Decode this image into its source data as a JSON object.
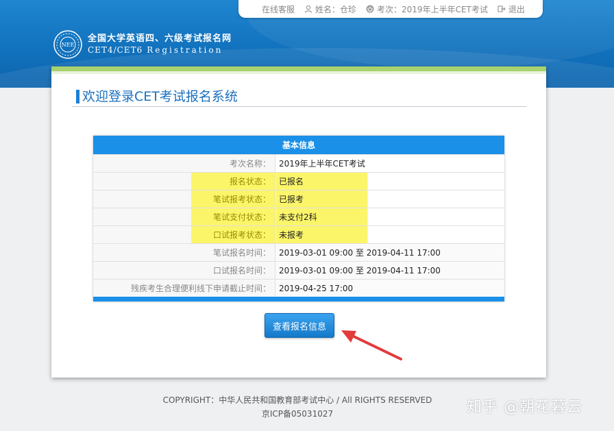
{
  "topbar": {
    "service": "在线客服",
    "name": "姓名：仓珍",
    "exam_session": "考次：2019年上半年CET考试",
    "logout": "退出"
  },
  "logo": {
    "seal_text": "NEE",
    "title_cn": "全国大学英语四、六级考试报名网",
    "title_en": "CET4/CET6",
    "title_en_reg": "Registration"
  },
  "main": {
    "welcome": "欢迎登录CET考试报名系统"
  },
  "info_table": {
    "header": "基本信息",
    "rows": [
      {
        "label": "考次名称：",
        "value": "2019年上半年CET考试"
      },
      {
        "label": "报名状态：",
        "value": "已报名"
      },
      {
        "label": "笔试报考状态：",
        "value": "已报考"
      },
      {
        "label": "笔试支付状态：",
        "value": "未支付2科"
      },
      {
        "label": "口试报考状态：",
        "value": "未报考"
      },
      {
        "label": "笔试报名时间：",
        "value": "2019-03-01 09:00 至 2019-04-11 17:00"
      },
      {
        "label": "口试报名时间：",
        "value": "2019-03-01 09:00 至 2019-04-11 17:00"
      },
      {
        "label": "残疾考生合理便利线下申请截止时间：",
        "value": "2019-04-25 17:00"
      }
    ]
  },
  "view_button": "查看报名信息",
  "footer": {
    "copyright": "COPYRIGHT：中华人民共和国教育部考试中心 / All RIGHTS RESERVED",
    "icp": "京ICP备05031027"
  },
  "watermark": "知乎 @朝花暮云",
  "colors": {
    "header_blue": "#1272bd",
    "table_header": "#1a90e8",
    "highlight": "#fbf56a",
    "accent_green": "#a8d26e",
    "arrow_red": "#e33b3b"
  }
}
